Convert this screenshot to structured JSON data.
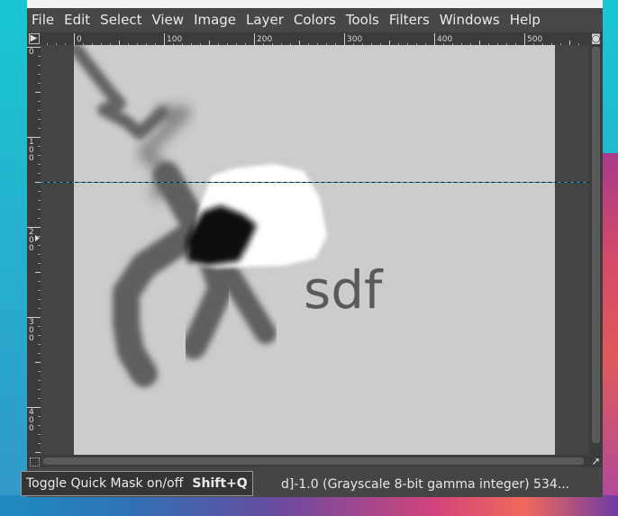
{
  "menu": [
    "File",
    "Edit",
    "Select",
    "View",
    "Image",
    "Layer",
    "Colors",
    "Tools",
    "Filters",
    "Windows",
    "Help"
  ],
  "ruler_top_labels": [
    "0",
    "100",
    "200",
    "300",
    "400",
    "500"
  ],
  "ruler_left_labels": [
    [
      "0"
    ],
    [
      "1",
      "0",
      "0"
    ],
    [
      "2",
      "0",
      "0"
    ],
    [
      "3",
      "0",
      "0"
    ],
    [
      "4",
      "0",
      "0"
    ]
  ],
  "canvas_text": "sdf",
  "status_text": "d]-1.0 (Grayscale 8-bit gamma integer) 534...",
  "tooltip": {
    "label": "Toggle Quick Mask on/off",
    "shortcut": "Shift+Q"
  },
  "colors": {
    "canvas_bg": "#cccccc",
    "paint": "#5f5f5f",
    "guide": "#2a8fb8",
    "window_bg": "#454545"
  },
  "icons": {
    "quick_mask": "dotted-square-icon",
    "navigate": "navigate-arrow-icon",
    "menu_toggle": "triangle-right-icon",
    "zoom": "zoom-lock-icon"
  }
}
